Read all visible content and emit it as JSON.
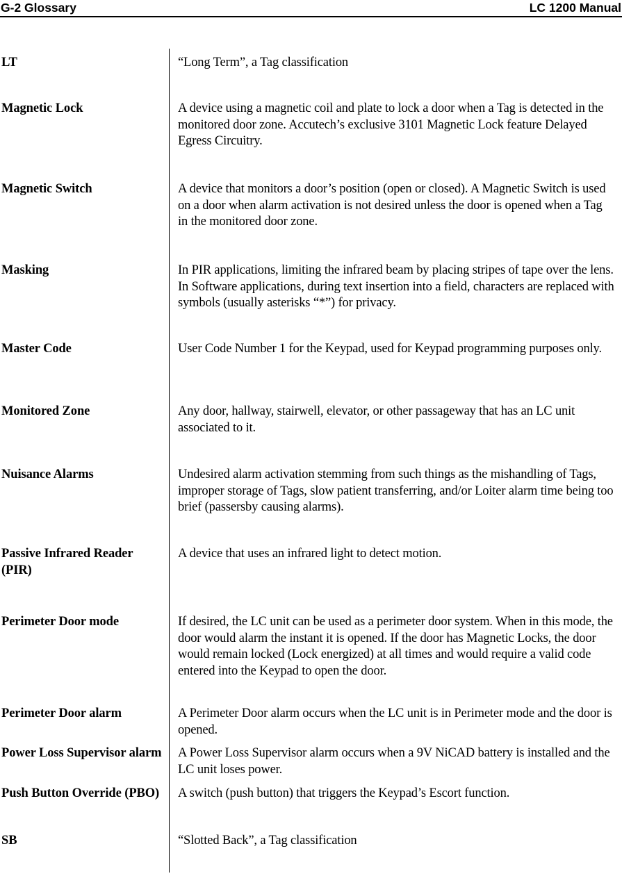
{
  "header": {
    "left": "G-2 Glossary",
    "right": "LC 1200 Manual"
  },
  "glossary": {
    "entries": [
      {
        "term": "LT",
        "definition": "“Long Term”, a Tag classification"
      },
      {
        "term": "Magnetic Lock",
        "definition": "A device using a magnetic coil and plate to lock a door when a Tag is detected in the monitored door zone. Accutech’s exclusive 3101 Magnetic Lock feature Delayed Egress Circuitry."
      },
      {
        "term": "Magnetic Switch",
        "definition": "A device that monitors a door’s position (open or closed). A Magnetic Switch is used on a door when alarm activation is not desired unless the door is opened when a Tag in the monitored door zone."
      },
      {
        "term": "Masking",
        "definition": "In PIR applications, limiting the infrared beam by placing stripes of tape over the lens.  In Software applications, during text insertion into a field, characters are replaced with symbols (usually asterisks “*”) for privacy."
      },
      {
        "term": "Master Code",
        "definition": "User Code Number 1 for the Keypad, used for Keypad programming purposes only."
      },
      {
        "term": "Monitored Zone",
        "definition": "Any door, hallway, stairwell, elevator, or other passageway that has an LC unit associated to it."
      },
      {
        "term": "Nuisance Alarms",
        "definition": "Undesired alarm activation stemming from such things as the mishandling of Tags, improper storage of Tags, slow patient transferring, and/or Loiter alarm time being too brief (passersby causing alarms)."
      },
      {
        "term": "Passive Infrared Reader (PIR)",
        "definition": "A device that uses an infrared light to detect motion."
      },
      {
        "term": "Perimeter Door mode",
        "definition": "If desired, the LC unit can be used as a perimeter door system. When in this mode, the door would alarm the instant it is opened. If the door has Magnetic Locks, the door would remain locked (Lock energized) at all times and would require a valid code entered into the Keypad to open the door."
      },
      {
        "term": "Perimeter Door alarm",
        "definition": "A Perimeter Door alarm occurs when the LC unit is in Perimeter mode and the door is opened."
      },
      {
        "term": "Power Loss Supervisor alarm",
        "definition": "A Power Loss Supervisor alarm occurs when a 9V NiCAD battery is installed and the LC unit loses power."
      },
      {
        "term": "Push Button Override (PBO)",
        "definition": "A switch (push button) that triggers the Keypad’s Escort function."
      },
      {
        "term": "SB",
        "definition": "“Slotted Back”, a Tag classification"
      }
    ]
  }
}
